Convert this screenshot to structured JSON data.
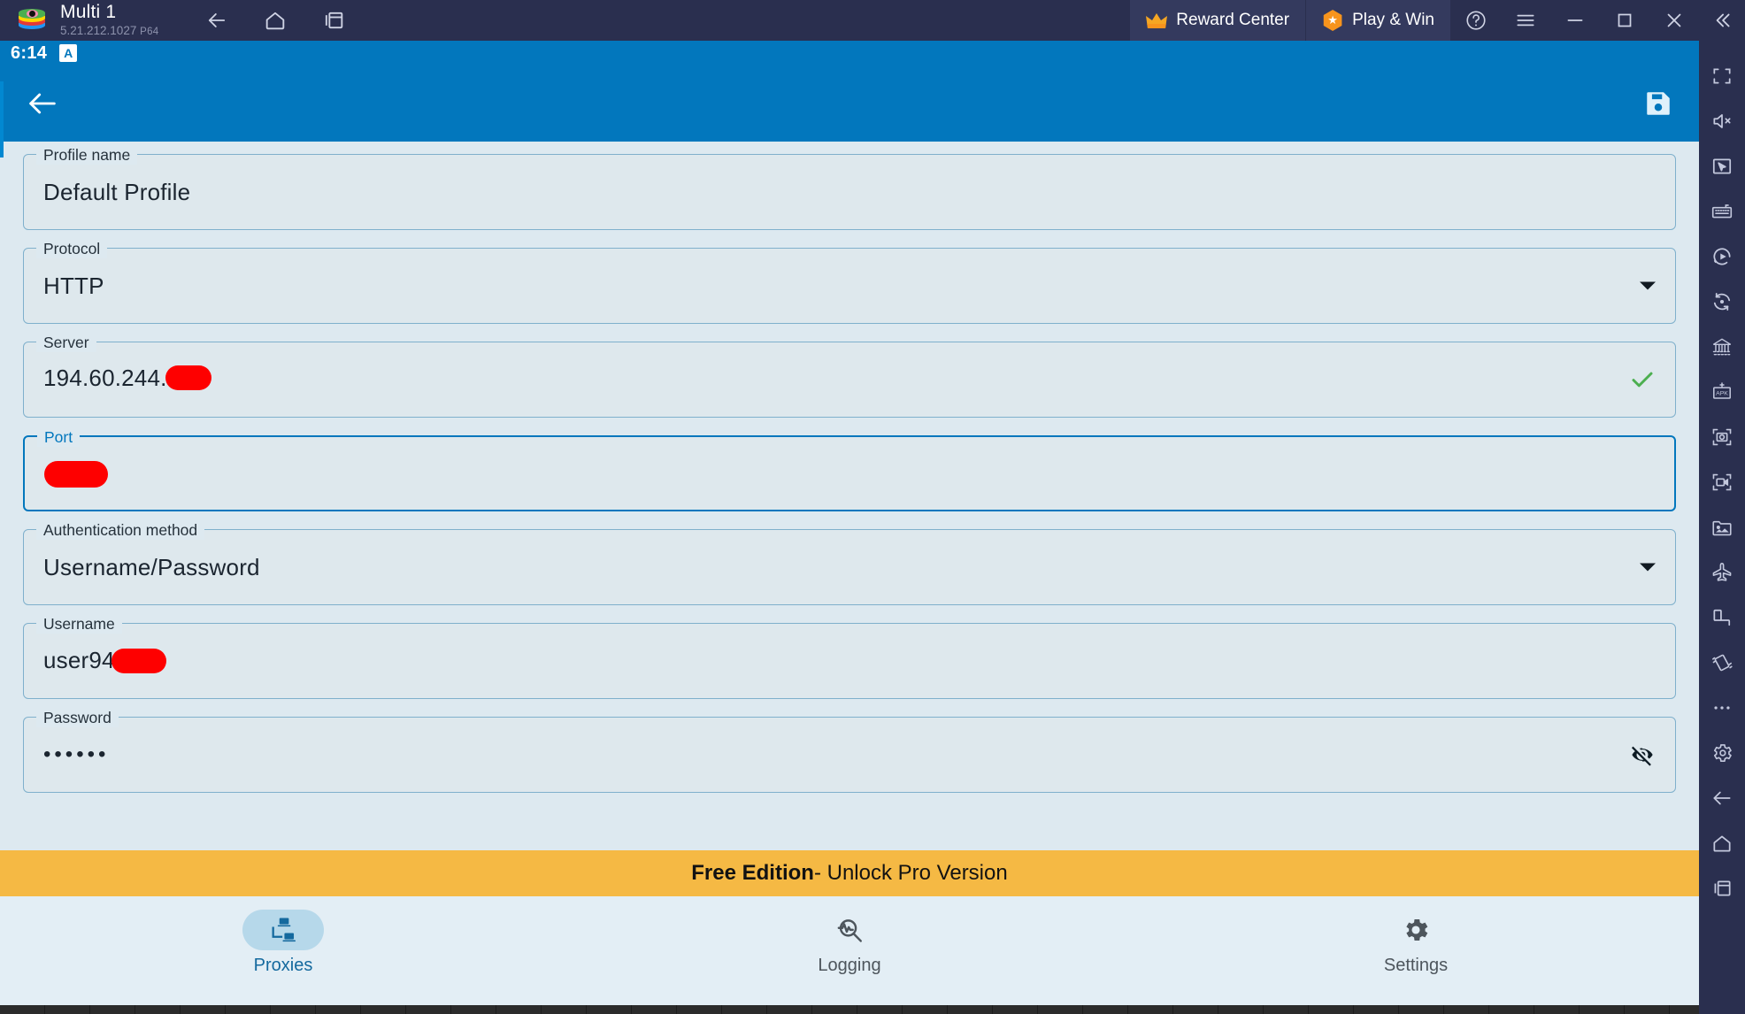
{
  "titlebar": {
    "instance_name": "Multi 1",
    "version": "5.21.212.1027",
    "arch": "P64",
    "nav": [
      {
        "name": "back-icon",
        "label": "Back"
      },
      {
        "name": "home-icon",
        "label": "Home"
      },
      {
        "name": "multi-window-icon",
        "label": "Multi-window"
      }
    ],
    "reward_center_label": "Reward Center",
    "play_win_label": "Play & Win",
    "window_buttons": [
      "help-icon",
      "menu-icon",
      "minimize-icon",
      "maximize-icon",
      "close-icon",
      "collapse-icon"
    ]
  },
  "status_bar": {
    "time": "6:14",
    "ime_badge": "A"
  },
  "app_bar": {
    "back_icon": "arrow-left-icon",
    "save_icon": "save-floppy-icon"
  },
  "form": {
    "fields": [
      {
        "id": "profile-name",
        "label": "Profile name",
        "value": "Default Profile",
        "type": "text",
        "focused": false,
        "trailing": "none"
      },
      {
        "id": "protocol",
        "label": "Protocol",
        "value": "HTTP",
        "type": "select",
        "focused": false,
        "trailing": "dropdown-arrow"
      },
      {
        "id": "server",
        "label": "Server",
        "value": "194.60.244.",
        "type": "text",
        "focused": false,
        "trailing": "valid-check",
        "redacted": "server"
      },
      {
        "id": "port",
        "label": "Port",
        "value": "",
        "type": "text",
        "focused": true,
        "trailing": "none",
        "redacted": "port"
      },
      {
        "id": "authentication-method",
        "label": "Authentication method",
        "value": "Username/Password",
        "type": "select",
        "focused": false,
        "trailing": "dropdown-arrow"
      },
      {
        "id": "username",
        "label": "Username",
        "value": "user94",
        "type": "text",
        "focused": false,
        "trailing": "none",
        "redacted": "user"
      },
      {
        "id": "password",
        "label": "Password",
        "value": "••••••",
        "type": "password",
        "focused": false,
        "trailing": "eye-off"
      }
    ]
  },
  "banner": {
    "edition": "Free Edition",
    "cta": " - Unlock Pro Version"
  },
  "bottom_nav": {
    "items": [
      {
        "id": "proxies",
        "label": "Proxies",
        "icon": "network-proxies-icon",
        "active": true
      },
      {
        "id": "logging",
        "label": "Logging",
        "icon": "log-monitor-icon",
        "active": false
      },
      {
        "id": "settings",
        "label": "Settings",
        "icon": "gear-icon",
        "active": false
      }
    ]
  },
  "sidebar": {
    "items": [
      {
        "name": "fullscreen-icon",
        "label": "Fullscreen"
      },
      {
        "name": "mute-icon",
        "label": "Mute"
      },
      {
        "name": "pointer-mapping-icon",
        "label": "Game controls"
      },
      {
        "name": "keyboard-icon",
        "label": "Keyboard mapping"
      },
      {
        "name": "macro-play-icon",
        "label": "Macro recorder"
      },
      {
        "name": "sync-operation-icon",
        "label": "Operation sync"
      },
      {
        "name": "multi-instance-icon",
        "label": "Multi-instance manager"
      },
      {
        "name": "install-apk-icon",
        "label": "Install APK"
      },
      {
        "name": "screenshot-icon",
        "label": "Screenshot"
      },
      {
        "name": "record-screen-icon",
        "label": "Screen record"
      },
      {
        "name": "media-manager-icon",
        "label": "Media manager"
      },
      {
        "name": "airplane-mode-icon",
        "label": "Airplane mode"
      },
      {
        "name": "rotate-screen-icon",
        "label": "Rotate"
      },
      {
        "name": "shake-icon",
        "label": "Shake"
      },
      {
        "name": "more-options-icon",
        "label": "More"
      },
      {
        "name": "settings-gear-icon",
        "label": "Settings"
      },
      {
        "name": "back-icon",
        "label": "Back"
      },
      {
        "name": "home-icon",
        "label": "Home"
      },
      {
        "name": "recents-icon",
        "label": "Recent apps"
      }
    ]
  },
  "colors": {
    "accent_blue": "#0277BD",
    "titlebar": "#2a2f4f",
    "banner_amber": "#f5b944",
    "screen_bg": "#dde9f0",
    "valid_green": "#4caf50",
    "redaction_red": "#fe0000"
  }
}
